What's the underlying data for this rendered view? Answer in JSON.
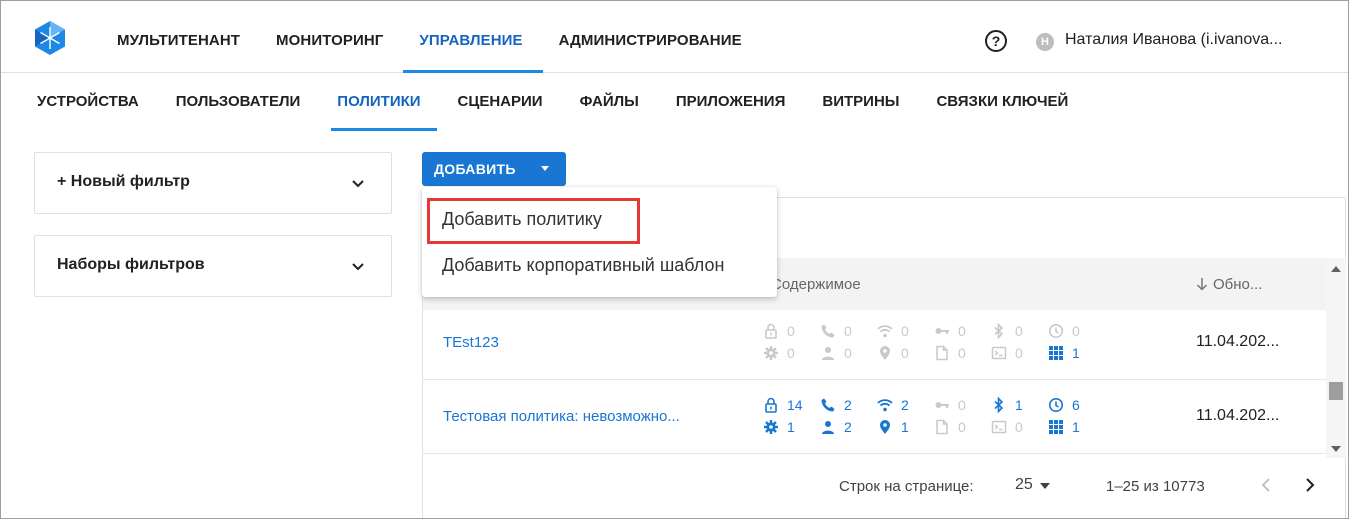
{
  "header": {
    "nav": [
      {
        "label": "МУЛЬТИТЕНАНТ",
        "active": false
      },
      {
        "label": "МОНИТОРИНГ",
        "active": false
      },
      {
        "label": "УПРАВЛЕНИЕ",
        "active": true
      },
      {
        "label": "АДМИНИСТРИРОВАНИЕ",
        "active": false
      }
    ],
    "help_icon": "?",
    "avatar_initial": "Н",
    "user_name": "Наталия Иванова (i.ivanova..."
  },
  "subnav": [
    {
      "label": "УСТРОЙСТВА",
      "active": false
    },
    {
      "label": "ПОЛЬЗОВАТЕЛИ",
      "active": false
    },
    {
      "label": "ПОЛИТИКИ",
      "active": true
    },
    {
      "label": "СЦЕНАРИИ",
      "active": false
    },
    {
      "label": "ФАЙЛЫ",
      "active": false
    },
    {
      "label": "ПРИЛОЖЕНИЯ",
      "active": false
    },
    {
      "label": "ВИТРИНЫ",
      "active": false
    },
    {
      "label": "СВЯЗКИ КЛЮЧЕЙ",
      "active": false
    }
  ],
  "filters": {
    "new_filter": "+ Новый фильтр",
    "filter_sets": "Наборы фильтров"
  },
  "add_button": {
    "label": "ДОБАВИТЬ"
  },
  "menu": {
    "add_policy": "Добавить политику",
    "add_corporate_template": "Добавить корпоративный шаблон"
  },
  "table": {
    "columns": {
      "content": "Содержимое",
      "updated": "Обно..."
    },
    "rows": [
      {
        "name": "TEst123",
        "date": "11.04.202...",
        "counts_top": [
          "0",
          "0",
          "0",
          "0",
          "0",
          "0"
        ],
        "counts_bottom": [
          "0",
          "0",
          "0",
          "0",
          "0",
          "1"
        ]
      },
      {
        "name": "Тестовая политика: невозможно...",
        "date": "11.04.202...",
        "counts_top": [
          "14",
          "2",
          "2",
          "0",
          "1",
          "6"
        ],
        "counts_bottom": [
          "1",
          "2",
          "1",
          "0",
          "0",
          "1"
        ]
      }
    ],
    "icon_names_top": [
      "lock-icon",
      "phone-icon",
      "wifi-icon",
      "key-icon",
      "bluetooth-icon",
      "clock-icon"
    ],
    "icon_names_bottom": [
      "gear-icon",
      "person-icon",
      "location-icon",
      "file-icon",
      "terminal-icon",
      "grid-icon"
    ]
  },
  "pagination": {
    "rows_per_page_label": "Строк на странице:",
    "rows_per_page": "25",
    "range": "1–25 из 10773"
  },
  "colors": {
    "accent": "#1976d2",
    "highlight": "#e53935",
    "dim_icon": "#c9c9c9"
  }
}
